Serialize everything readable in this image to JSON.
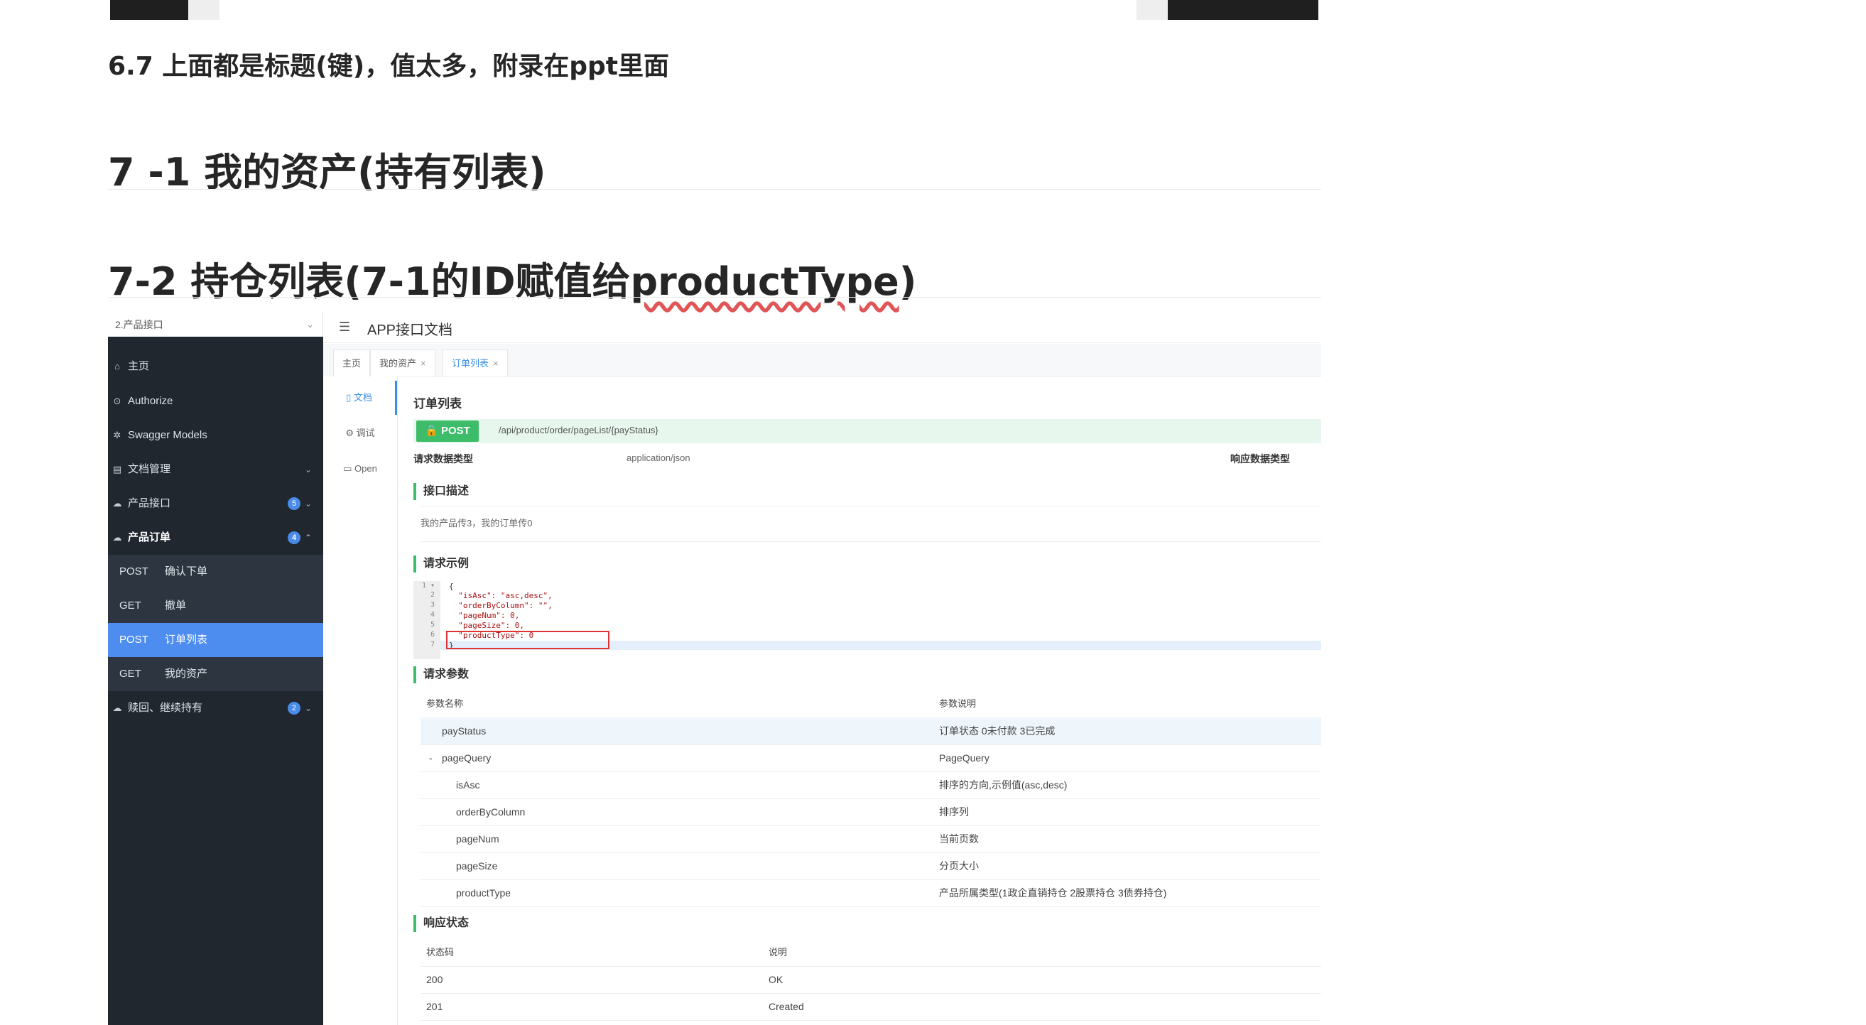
{
  "doc": {
    "heading_67": "6.7 上面都是标题(键)，值太多，附录在ppt里面",
    "heading_71": "7 -1 我的资产(持有列表)",
    "heading_72_prefix": "7-2 持仓列表(7-1的ID赋值给",
    "heading_72_word": "productType",
    "heading_72_suffix": ")"
  },
  "app": {
    "group_select": "2.产品接口",
    "title": "APP接口文档",
    "sidebar": {
      "home": "主页",
      "authorize": "Authorize",
      "swagger_models": "Swagger Models",
      "doc_manage": "文档管理",
      "product_api": "产品接口",
      "product_api_count": "5",
      "product_order": "产品订单",
      "product_order_count": "4",
      "sub": [
        {
          "method": "POST",
          "label": "确认下单"
        },
        {
          "method": "GET",
          "label": "撤单"
        },
        {
          "method": "POST",
          "label": "订单列表"
        },
        {
          "method": "GET",
          "label": "我的资产"
        }
      ],
      "redeem": "赎回、继续持有",
      "redeem_count": "2"
    },
    "tabs": [
      "主页",
      "我的资产",
      "订单列表"
    ],
    "leftnav": [
      "文档",
      "调试",
      "Open"
    ],
    "page": {
      "title": "订单列表",
      "method": "POST",
      "path": "/api/product/order/pageList/{payStatus}",
      "req_type_label": "请求数据类型",
      "req_type_value": "application/json",
      "resp_type_label": "响应数据类型",
      "desc_title": "接口描述",
      "desc_text": "我的产品传3，我的订单传0",
      "example_title": "请求示例",
      "params_title": "请求参数",
      "params_head": [
        "参数名称",
        "参数说明"
      ],
      "params": [
        {
          "name": "payStatus",
          "desc": "订单状态 0未付款 3已完成"
        },
        {
          "name": "pageQuery",
          "desc": "PageQuery"
        },
        {
          "name": "isAsc",
          "desc": "排序的方向,示例值(asc,desc)"
        },
        {
          "name": "orderByColumn",
          "desc": "排序列"
        },
        {
          "name": "pageNum",
          "desc": "当前页数"
        },
        {
          "name": "pageSize",
          "desc": "分页大小"
        },
        {
          "name": "productType",
          "desc": "产品所属类型(1政企直销持仓 2股票持仓 3债券持仓)"
        }
      ],
      "collapse_marker": "-",
      "resp_title": "响应状态",
      "resp_head": [
        "状态码",
        "说明"
      ],
      "resp": [
        {
          "code": "200",
          "desc": "OK"
        },
        {
          "code": "201",
          "desc": "Created"
        }
      ]
    },
    "code_lines": {
      "l1": "{",
      "l2": "  \"isAsc\": \"asc,desc\",",
      "l3": "  \"orderByColumn\": \"\",",
      "l4": "  \"pageNum\": 0,",
      "l5": "  \"pageSize\": 0,",
      "l6": "  \"productType\": 0",
      "l7": "}"
    }
  }
}
